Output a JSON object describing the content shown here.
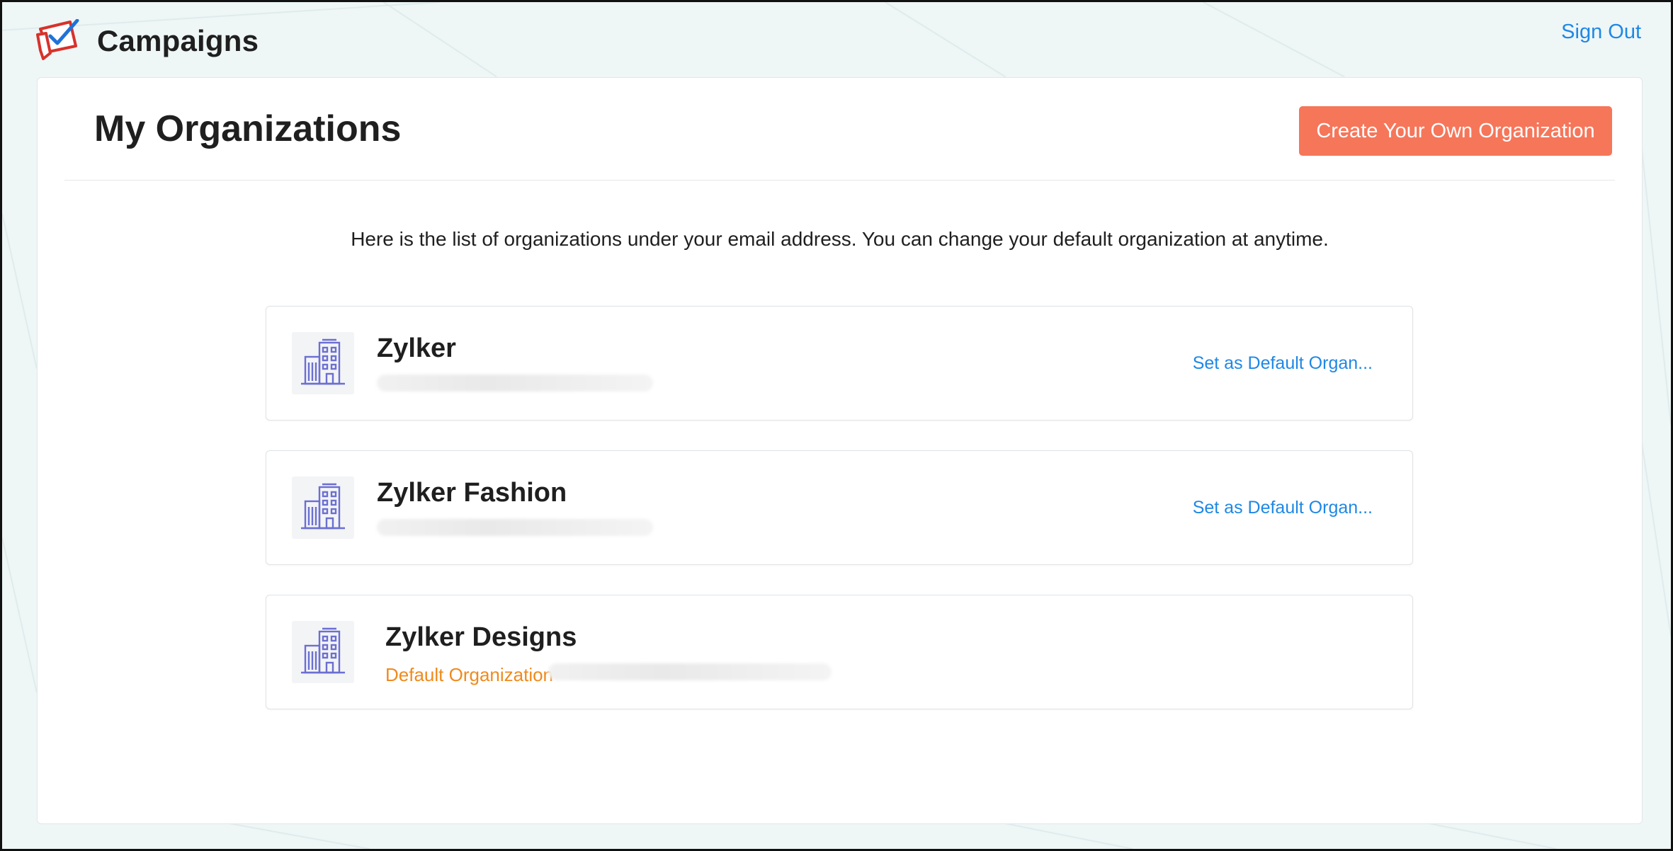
{
  "app": {
    "name": "Campaigns",
    "sign_out_label": "Sign Out"
  },
  "page": {
    "title": "My Organizations",
    "create_button_label": "Create Your Own Organization",
    "intro_text": "Here is the list of organizations under your email address. You can change your default organization at anytime."
  },
  "organizations": [
    {
      "name": "Zylker",
      "action_label": "Set as Default Organ...",
      "is_default": false,
      "icon": "building-icon"
    },
    {
      "name": "Zylker Fashion",
      "action_label": "Set as Default Organ...",
      "is_default": false,
      "icon": "building-icon"
    },
    {
      "name": "Zylker Designs",
      "default_label": "Default Organization",
      "is_default": true,
      "icon": "building-icon"
    }
  ],
  "colors": {
    "accent_orange": "#f6765a",
    "link_blue": "#1e88e5",
    "default_orange": "#f08a1c",
    "icon_purple": "#6b6fd1"
  }
}
